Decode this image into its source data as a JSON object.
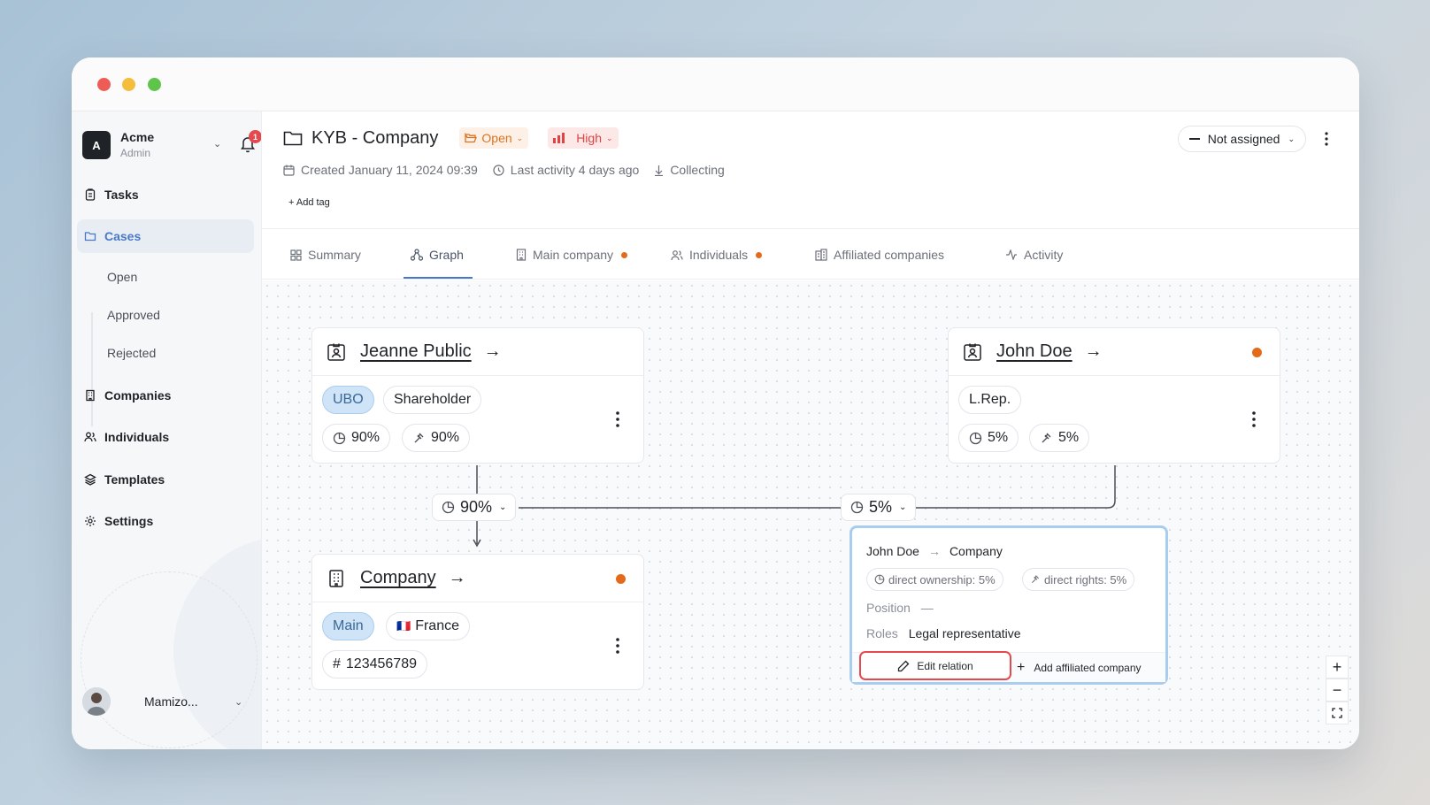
{
  "window": {
    "controls": [
      "close",
      "minimize",
      "maximize"
    ]
  },
  "sidebar": {
    "org": {
      "initial": "A",
      "name": "Acme",
      "role": "Admin",
      "notifications": "1"
    },
    "items": [
      {
        "label": "Tasks",
        "icon": "clipboard-icon"
      },
      {
        "label": "Cases",
        "icon": "folder-icon",
        "active": true
      },
      {
        "label": "Companies",
        "icon": "building-icon"
      },
      {
        "label": "Individuals",
        "icon": "users-icon"
      },
      {
        "label": "Templates",
        "icon": "layers-icon"
      },
      {
        "label": "Settings",
        "icon": "gear-icon"
      }
    ],
    "cases_sub": [
      "Open",
      "Approved",
      "Rejected"
    ],
    "user": {
      "name": "Mamizo..."
    }
  },
  "header": {
    "title": "KYB - Company",
    "status": "Open",
    "priority": "High",
    "created": "Created January 11, 2024 09:39",
    "last_activity": "Last activity 4 days ago",
    "stage": "Collecting",
    "add_tag": "Add tag",
    "assignee": "Not assigned"
  },
  "tabs": [
    {
      "label": "Summary"
    },
    {
      "label": "Graph",
      "active": true
    },
    {
      "label": "Main company",
      "dot": true
    },
    {
      "label": "Individuals",
      "dot": true
    },
    {
      "label": "Affiliated companies"
    },
    {
      "label": "Activity"
    }
  ],
  "graph": {
    "nodes": {
      "jeanne": {
        "name": "Jeanne Public",
        "tags": [
          "UBO",
          "Shareholder"
        ],
        "ownership": "90%",
        "rights": "90%"
      },
      "john": {
        "name": "John Doe",
        "tags": [
          "L.Rep."
        ],
        "ownership": "5%",
        "rights": "5%",
        "flag": true
      },
      "company": {
        "name": "Company",
        "tags": [
          "Main"
        ],
        "country": "France",
        "country_flag": "🇫🇷",
        "reg_number": "123456789",
        "flag": true
      }
    },
    "edges": [
      {
        "from": "Jeanne Public",
        "to": "Company",
        "label": "90%"
      },
      {
        "from": "John Doe",
        "to": "Company",
        "label": "5%"
      }
    ],
    "relation_popup": {
      "from": "John Doe",
      "to": "Company",
      "direct_ownership": "direct ownership: 5%",
      "direct_rights": "direct rights: 5%",
      "position_label": "Position",
      "position_value": "—",
      "roles_label": "Roles",
      "roles_value": "Legal representative",
      "edit_label": "Edit relation",
      "add_label": "Add affiliated company"
    },
    "zoom_controls": {
      "zoom_in": "+",
      "zoom_out": "−"
    }
  },
  "colors": {
    "accent": "#4a78c9",
    "warning": "#e36a1a",
    "danger": "#e5484d",
    "ubo_bg": "#cfe4f7"
  }
}
